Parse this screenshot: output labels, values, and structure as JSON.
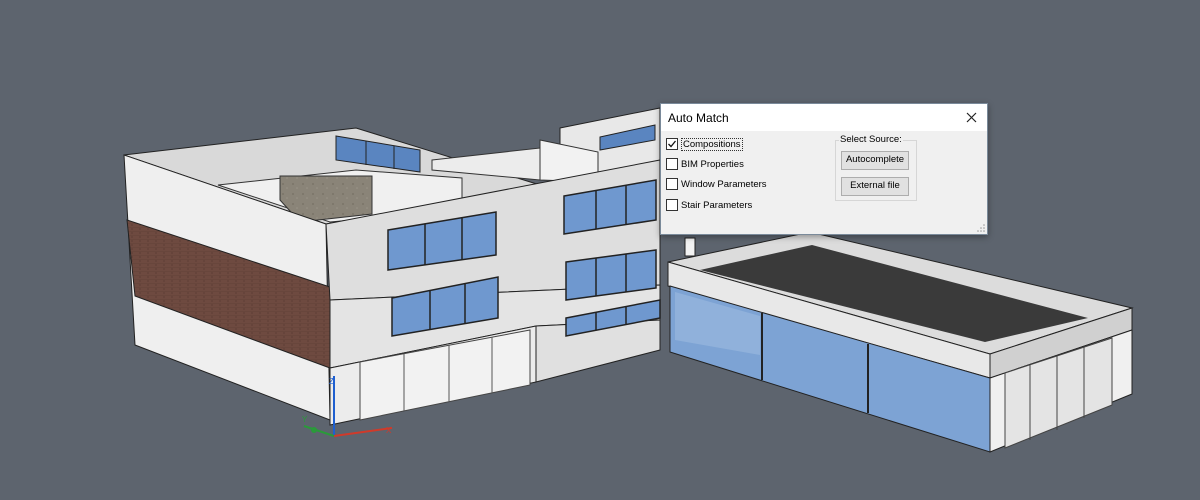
{
  "dialog": {
    "title": "Auto Match",
    "close_icon": "close-icon",
    "checkboxes": [
      {
        "label": "Compositions",
        "checked": true
      },
      {
        "label": "BIM Properties",
        "checked": false
      },
      {
        "label": "Window Parameters",
        "checked": false
      },
      {
        "label": "Stair Parameters",
        "checked": false
      }
    ],
    "source_group": {
      "title": "Select Source:",
      "autocomplete_label": "Autocomplete",
      "external_file_label": "External file"
    }
  },
  "viewport": {
    "background": "#5d646e",
    "axis_colors": {
      "x": "#d03a2a",
      "y": "#2a9a3a",
      "z": "#1e5fd0"
    },
    "axis_labels": {
      "x": "X",
      "y": "Y",
      "z": "Z"
    }
  }
}
